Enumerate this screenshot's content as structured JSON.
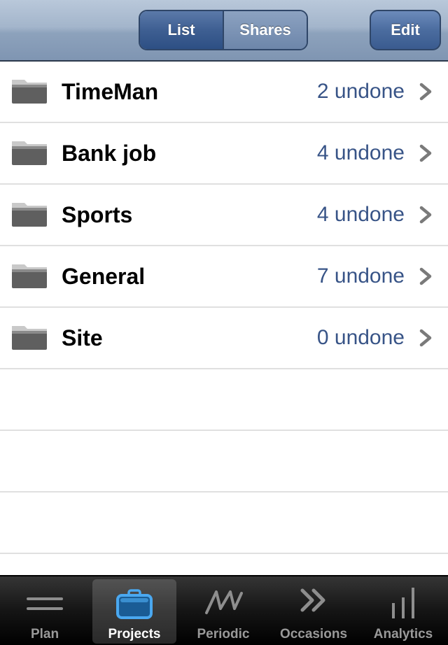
{
  "navbar": {
    "segments": [
      {
        "label": "List",
        "selected": true
      },
      {
        "label": "Shares",
        "selected": false
      }
    ],
    "edit_label": "Edit"
  },
  "projects": [
    {
      "name": "TimeMan",
      "count": "2 undone"
    },
    {
      "name": "Bank job",
      "count": "4 undone"
    },
    {
      "name": "Sports",
      "count": "4 undone"
    },
    {
      "name": "General",
      "count": "7 undone"
    },
    {
      "name": "Site",
      "count": "0 undone"
    }
  ],
  "tabbar": {
    "tabs": [
      {
        "label": "Plan",
        "icon": "plan-icon",
        "selected": false
      },
      {
        "label": "Projects",
        "icon": "briefcase-icon",
        "selected": true
      },
      {
        "label": "Periodic",
        "icon": "periodic-icon",
        "selected": false
      },
      {
        "label": "Occasions",
        "icon": "double-chevron-icon",
        "selected": false
      },
      {
        "label": "Analytics",
        "icon": "bar-chart-icon",
        "selected": false
      }
    ]
  },
  "colors": {
    "accent_count": "#385487",
    "navbar": "#8da2bc",
    "selected_tab_icon": "#4aa8f0"
  }
}
